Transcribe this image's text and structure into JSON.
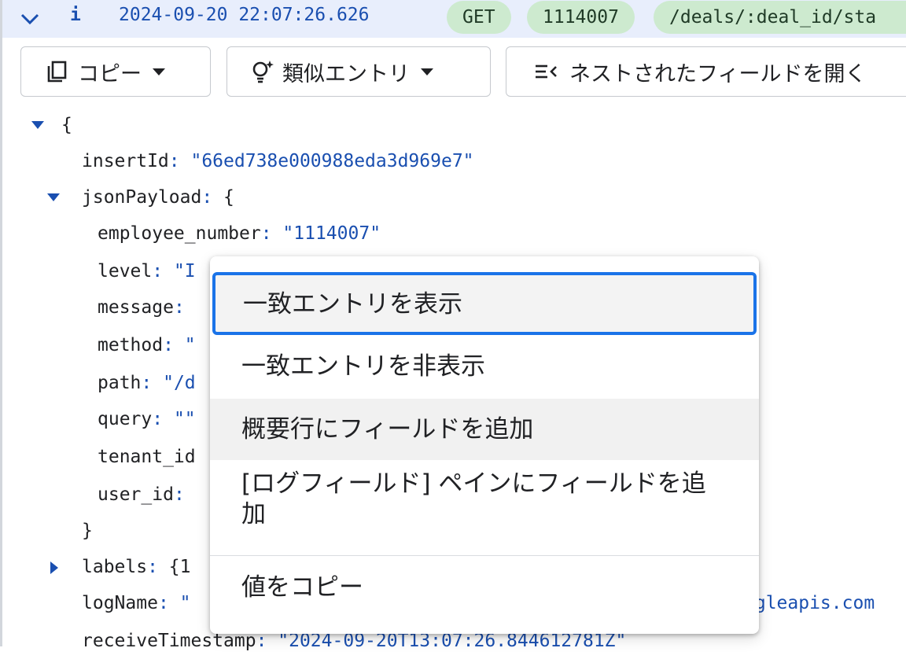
{
  "header": {
    "info_letter": "i",
    "timestamp": "2024-09-20 22:07:26.626",
    "chips": {
      "method": "GET",
      "employee": "1114007",
      "path": "/deals/:deal_id/sta"
    }
  },
  "toolbar": {
    "copy_label": "コピー",
    "similar_label": "類似エントリ",
    "expand_label": "ネストされたフィールドを開く"
  },
  "tree": {
    "open_brace": "{",
    "insertId": {
      "key": "insertId",
      "value": "\"66ed738e000988eda3d969e7\""
    },
    "jsonPayload": {
      "key": "jsonPayload"
    },
    "fields": [
      {
        "key": "employee_number",
        "value": "\"1114007\""
      },
      {
        "key": "level",
        "value": "\"I"
      },
      {
        "key": "message",
        "value": ""
      },
      {
        "key": "method",
        "value": "\""
      },
      {
        "key": "path",
        "value": "\"/d"
      },
      {
        "key": "query",
        "value": "\"\""
      },
      {
        "key": "tenant_id",
        "value": ""
      },
      {
        "key": "user_id",
        "value": ""
      }
    ],
    "close_brace": "}",
    "labels": {
      "key": "labels",
      "value": "{1"
    },
    "logName": {
      "key": "logName",
      "value": "\"",
      "tail": "ogleapis.com"
    },
    "receiveTimestamp": {
      "key": "receiveTimestamp",
      "value": "\"2024-09-20T13:07:26.844612781Z\""
    }
  },
  "menu": {
    "items": [
      "一致エントリを表示",
      "一致エントリを非表示",
      "概要行にフィールドを追加",
      "[ログフィールド] ペインにフィールドを追加",
      "値をコピー"
    ]
  },
  "colors": {
    "header_bg": "#e8eefc",
    "chip_bg": "#cdeacf",
    "accent": "#1a4fb0",
    "focus_ring": "#1a73e8"
  },
  "icons": [
    "chevron-down-icon",
    "copy-icon",
    "lightbulb-sparkle-icon",
    "expand-list-icon",
    "caret-down-icon",
    "triangle-down-icon",
    "triangle-right-icon"
  ]
}
